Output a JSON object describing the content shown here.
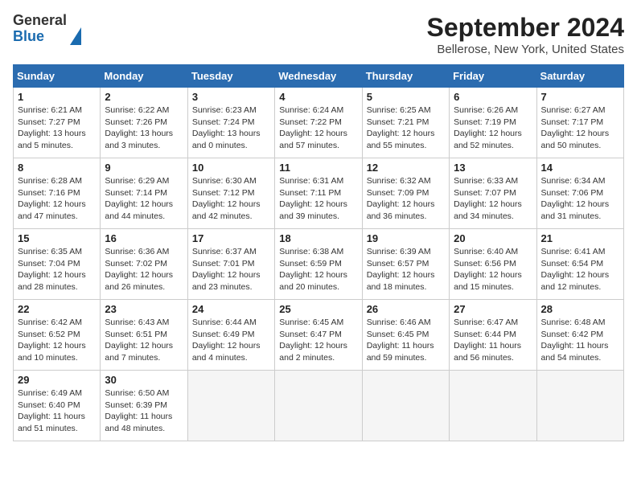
{
  "header": {
    "logo_line1": "General",
    "logo_line2": "Blue",
    "title": "September 2024",
    "subtitle": "Bellerose, New York, United States"
  },
  "calendar": {
    "days_of_week": [
      "Sunday",
      "Monday",
      "Tuesday",
      "Wednesday",
      "Thursday",
      "Friday",
      "Saturday"
    ],
    "weeks": [
      [
        {
          "day": "1",
          "info": "Sunrise: 6:21 AM\nSunset: 7:27 PM\nDaylight: 13 hours\nand 5 minutes."
        },
        {
          "day": "2",
          "info": "Sunrise: 6:22 AM\nSunset: 7:26 PM\nDaylight: 13 hours\nand 3 minutes."
        },
        {
          "day": "3",
          "info": "Sunrise: 6:23 AM\nSunset: 7:24 PM\nDaylight: 13 hours\nand 0 minutes."
        },
        {
          "day": "4",
          "info": "Sunrise: 6:24 AM\nSunset: 7:22 PM\nDaylight: 12 hours\nand 57 minutes."
        },
        {
          "day": "5",
          "info": "Sunrise: 6:25 AM\nSunset: 7:21 PM\nDaylight: 12 hours\nand 55 minutes."
        },
        {
          "day": "6",
          "info": "Sunrise: 6:26 AM\nSunset: 7:19 PM\nDaylight: 12 hours\nand 52 minutes."
        },
        {
          "day": "7",
          "info": "Sunrise: 6:27 AM\nSunset: 7:17 PM\nDaylight: 12 hours\nand 50 minutes."
        }
      ],
      [
        {
          "day": "8",
          "info": "Sunrise: 6:28 AM\nSunset: 7:16 PM\nDaylight: 12 hours\nand 47 minutes."
        },
        {
          "day": "9",
          "info": "Sunrise: 6:29 AM\nSunset: 7:14 PM\nDaylight: 12 hours\nand 44 minutes."
        },
        {
          "day": "10",
          "info": "Sunrise: 6:30 AM\nSunset: 7:12 PM\nDaylight: 12 hours\nand 42 minutes."
        },
        {
          "day": "11",
          "info": "Sunrise: 6:31 AM\nSunset: 7:11 PM\nDaylight: 12 hours\nand 39 minutes."
        },
        {
          "day": "12",
          "info": "Sunrise: 6:32 AM\nSunset: 7:09 PM\nDaylight: 12 hours\nand 36 minutes."
        },
        {
          "day": "13",
          "info": "Sunrise: 6:33 AM\nSunset: 7:07 PM\nDaylight: 12 hours\nand 34 minutes."
        },
        {
          "day": "14",
          "info": "Sunrise: 6:34 AM\nSunset: 7:06 PM\nDaylight: 12 hours\nand 31 minutes."
        }
      ],
      [
        {
          "day": "15",
          "info": "Sunrise: 6:35 AM\nSunset: 7:04 PM\nDaylight: 12 hours\nand 28 minutes."
        },
        {
          "day": "16",
          "info": "Sunrise: 6:36 AM\nSunset: 7:02 PM\nDaylight: 12 hours\nand 26 minutes."
        },
        {
          "day": "17",
          "info": "Sunrise: 6:37 AM\nSunset: 7:01 PM\nDaylight: 12 hours\nand 23 minutes."
        },
        {
          "day": "18",
          "info": "Sunrise: 6:38 AM\nSunset: 6:59 PM\nDaylight: 12 hours\nand 20 minutes."
        },
        {
          "day": "19",
          "info": "Sunrise: 6:39 AM\nSunset: 6:57 PM\nDaylight: 12 hours\nand 18 minutes."
        },
        {
          "day": "20",
          "info": "Sunrise: 6:40 AM\nSunset: 6:56 PM\nDaylight: 12 hours\nand 15 minutes."
        },
        {
          "day": "21",
          "info": "Sunrise: 6:41 AM\nSunset: 6:54 PM\nDaylight: 12 hours\nand 12 minutes."
        }
      ],
      [
        {
          "day": "22",
          "info": "Sunrise: 6:42 AM\nSunset: 6:52 PM\nDaylight: 12 hours\nand 10 minutes."
        },
        {
          "day": "23",
          "info": "Sunrise: 6:43 AM\nSunset: 6:51 PM\nDaylight: 12 hours\nand 7 minutes."
        },
        {
          "day": "24",
          "info": "Sunrise: 6:44 AM\nSunset: 6:49 PM\nDaylight: 12 hours\nand 4 minutes."
        },
        {
          "day": "25",
          "info": "Sunrise: 6:45 AM\nSunset: 6:47 PM\nDaylight: 12 hours\nand 2 minutes."
        },
        {
          "day": "26",
          "info": "Sunrise: 6:46 AM\nSunset: 6:45 PM\nDaylight: 11 hours\nand 59 minutes."
        },
        {
          "day": "27",
          "info": "Sunrise: 6:47 AM\nSunset: 6:44 PM\nDaylight: 11 hours\nand 56 minutes."
        },
        {
          "day": "28",
          "info": "Sunrise: 6:48 AM\nSunset: 6:42 PM\nDaylight: 11 hours\nand 54 minutes."
        }
      ],
      [
        {
          "day": "29",
          "info": "Sunrise: 6:49 AM\nSunset: 6:40 PM\nDaylight: 11 hours\nand 51 minutes."
        },
        {
          "day": "30",
          "info": "Sunrise: 6:50 AM\nSunset: 6:39 PM\nDaylight: 11 hours\nand 48 minutes."
        },
        {
          "day": "",
          "info": ""
        },
        {
          "day": "",
          "info": ""
        },
        {
          "day": "",
          "info": ""
        },
        {
          "day": "",
          "info": ""
        },
        {
          "day": "",
          "info": ""
        }
      ]
    ]
  }
}
